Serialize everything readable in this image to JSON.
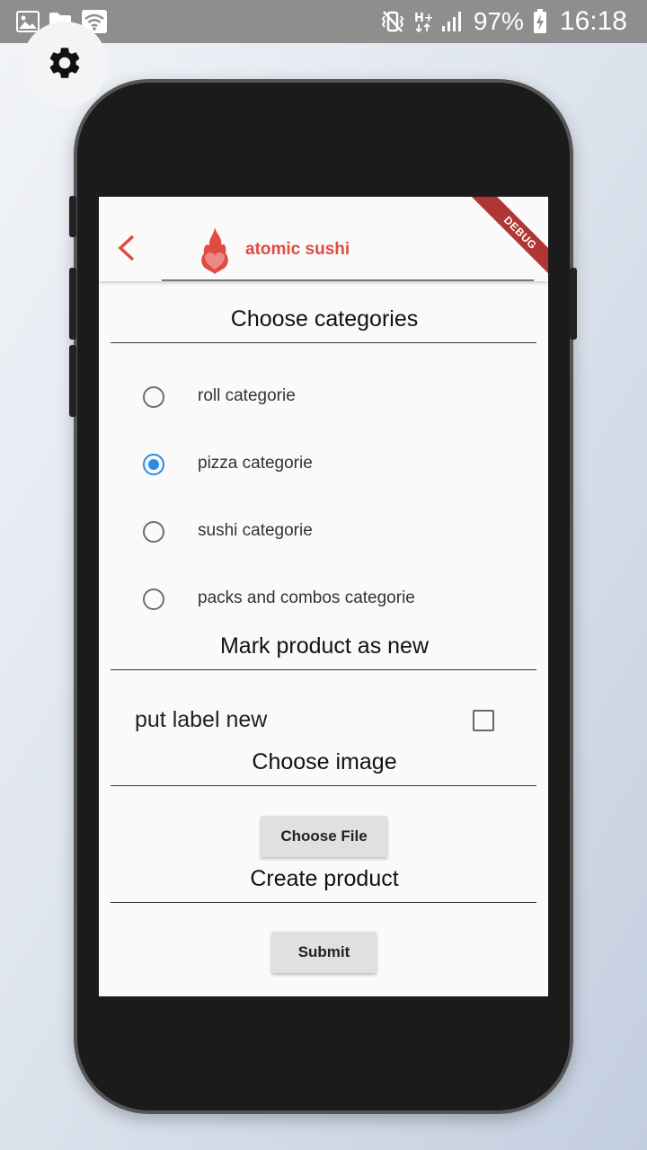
{
  "status_bar": {
    "battery": "97%",
    "time": "16:18",
    "left_icons": [
      "image-icon",
      "folder-icon",
      "wifi-icon"
    ],
    "right_icons": [
      "mute-vibrate-icon",
      "network-h-plus-icon",
      "signal-icon",
      "battery-charging-icon"
    ]
  },
  "app": {
    "brand": "atomic sushi",
    "debug_banner": "DEBUG",
    "accent_color": "#e04a43",
    "selected_color": "#2c8ae3"
  },
  "form": {
    "categories_title": "Choose categories",
    "categories": [
      {
        "label": "roll categorie",
        "selected": false
      },
      {
        "label": "pizza categorie",
        "selected": true
      },
      {
        "label": "sushi categorie",
        "selected": false
      },
      {
        "label": "packs and combos categorie",
        "selected": false
      }
    ],
    "new_title": "Mark product as new",
    "new_checkbox_label": "put label new",
    "new_checked": false,
    "image_title": "Choose image",
    "choose_file_label": "Choose File",
    "create_title": "Create product",
    "submit_label": "Submit"
  }
}
